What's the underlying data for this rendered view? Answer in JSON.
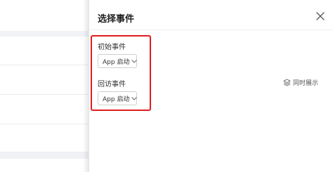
{
  "drawer": {
    "title": "选择事件",
    "close_icon": "close-icon"
  },
  "fields": {
    "initial_event": {
      "label": "初始事件",
      "value": "App 启动"
    },
    "return_event": {
      "label": "回访事件",
      "value": "App 启动"
    }
  },
  "actions": {
    "simultaneous_label": "同时展示",
    "simultaneous_icon": "layers-icon"
  },
  "colors": {
    "highlight": "#e11d1d",
    "background_band": "#f1f2f5"
  }
}
